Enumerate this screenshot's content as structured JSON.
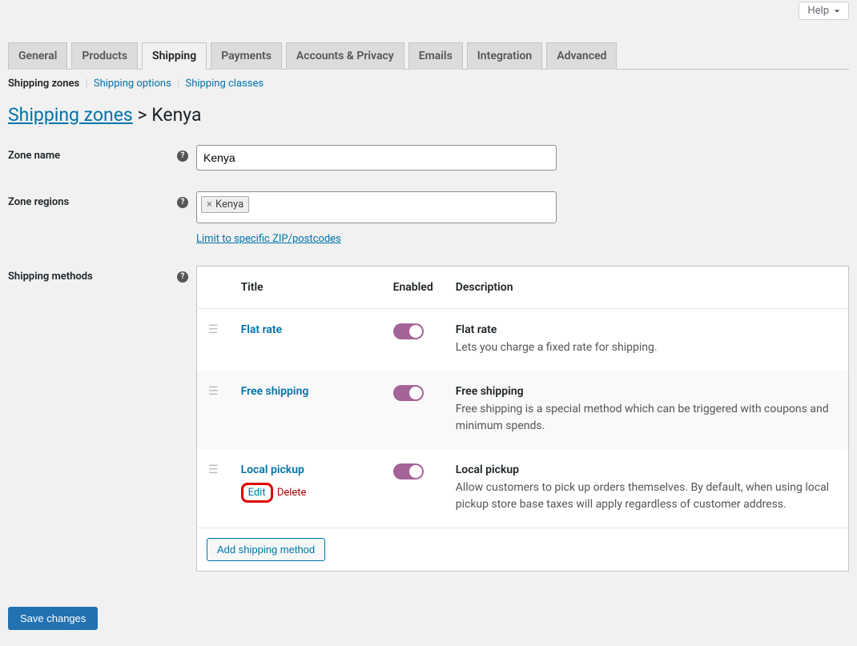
{
  "help": {
    "label": "Help"
  },
  "tabs": [
    {
      "label": "General"
    },
    {
      "label": "Products"
    },
    {
      "label": "Shipping",
      "active": true
    },
    {
      "label": "Payments"
    },
    {
      "label": "Accounts & Privacy"
    },
    {
      "label": "Emails"
    },
    {
      "label": "Integration"
    },
    {
      "label": "Advanced"
    }
  ],
  "subtabs": {
    "zones": "Shipping zones",
    "options": "Shipping options",
    "classes": "Shipping classes"
  },
  "breadcrumb": {
    "root": "Shipping zones",
    "sep": ">",
    "leaf": "Kenya"
  },
  "labels": {
    "zone_name": "Zone name",
    "zone_regions": "Zone regions",
    "shipping_methods": "Shipping methods"
  },
  "zone": {
    "name_value": "Kenya",
    "region_chip": "Kenya",
    "limit_link": "Limit to specific ZIP/postcodes"
  },
  "table": {
    "headers": {
      "title": "Title",
      "enabled": "Enabled",
      "description": "Description"
    },
    "rows": [
      {
        "title": "Flat rate",
        "desc_head": "Flat rate",
        "desc_body": "Lets you charge a fixed rate for shipping."
      },
      {
        "title": "Free shipping",
        "desc_head": "Free shipping",
        "desc_body": "Free shipping is a special method which can be triggered with coupons and minimum spends."
      },
      {
        "title": "Local pickup",
        "desc_head": "Local pickup",
        "desc_body": "Allow customers to pick up orders themselves. By default, when using local pickup store base taxes will apply regardless of customer address.",
        "actions": {
          "edit": "Edit",
          "delete": "Delete"
        }
      }
    ],
    "add_method": "Add shipping method"
  },
  "save_button": "Save changes"
}
